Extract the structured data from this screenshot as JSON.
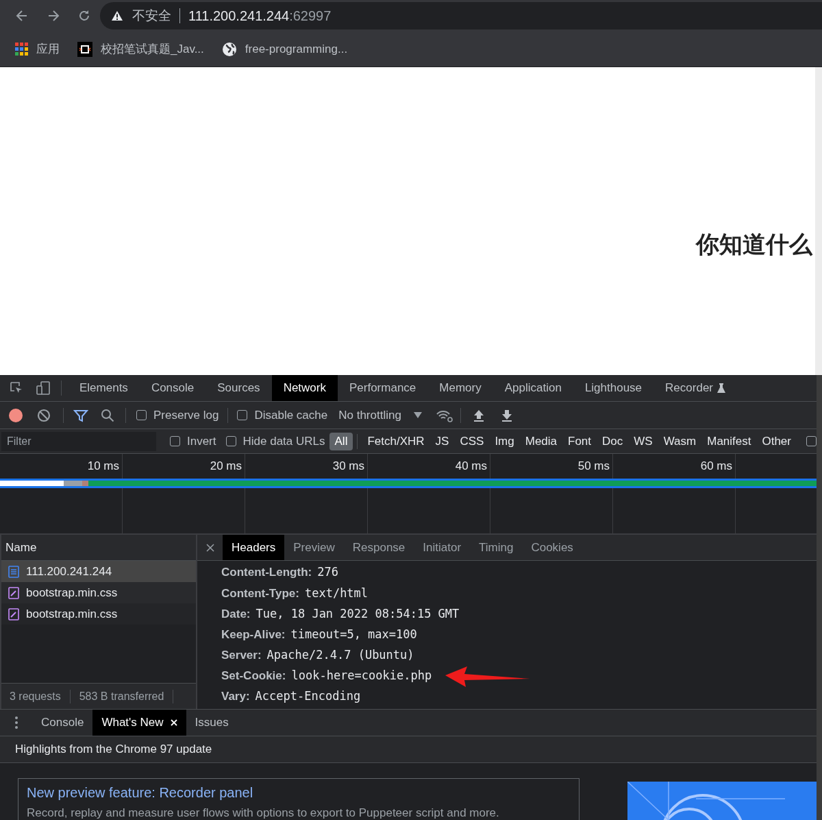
{
  "browser": {
    "security_label": "不安全",
    "url_host": "111.200.241.244",
    "url_port": ":62997",
    "bookmarks": [
      {
        "kind": "apps",
        "label": "应用"
      },
      {
        "kind": "site",
        "label": "校招笔试真题_Jav..."
      },
      {
        "kind": "globe",
        "label": "free-programming..."
      }
    ]
  },
  "page": {
    "heading": "你知道什么"
  },
  "devtools": {
    "tabs": [
      {
        "label": "Elements",
        "selected": false
      },
      {
        "label": "Console",
        "selected": false
      },
      {
        "label": "Sources",
        "selected": false
      },
      {
        "label": "Network",
        "selected": true
      },
      {
        "label": "Performance",
        "selected": false
      },
      {
        "label": "Memory",
        "selected": false
      },
      {
        "label": "Application",
        "selected": false
      },
      {
        "label": "Lighthouse",
        "selected": false
      },
      {
        "label": "Recorder",
        "selected": false
      }
    ],
    "toolbar": {
      "recording": true,
      "preserve_log": {
        "label": "Preserve log",
        "checked": false
      },
      "disable_cache": {
        "label": "Disable cache",
        "checked": false
      },
      "throttling": "No throttling"
    },
    "filter": {
      "placeholder": "Filter",
      "checkboxes": [
        {
          "label": "Invert",
          "checked": false
        },
        {
          "label": "Hide data URLs",
          "checked": false
        }
      ],
      "types": [
        {
          "label": "All",
          "selected": true
        },
        {
          "label": "Fetch/XHR",
          "selected": false
        },
        {
          "label": "JS",
          "selected": false
        },
        {
          "label": "CSS",
          "selected": false
        },
        {
          "label": "Img",
          "selected": false
        },
        {
          "label": "Media",
          "selected": false
        },
        {
          "label": "Font",
          "selected": false
        },
        {
          "label": "Doc",
          "selected": false
        },
        {
          "label": "WS",
          "selected": false
        },
        {
          "label": "Wasm",
          "selected": false
        },
        {
          "label": "Manifest",
          "selected": false
        },
        {
          "label": "Other",
          "selected": false
        }
      ],
      "trailing_checkbox": {
        "checked": false
      }
    },
    "timeline": {
      "ticks": [
        "10 ms",
        "20 ms",
        "30 ms",
        "40 ms",
        "50 ms",
        "60 ms"
      ]
    },
    "requests": {
      "column": "Name",
      "rows": [
        {
          "kind": "document",
          "name": "111.200.241.244",
          "selected": true
        },
        {
          "kind": "stylesheet",
          "name": "bootstrap.min.css",
          "selected": false
        },
        {
          "kind": "stylesheet",
          "name": "bootstrap.min.css",
          "selected": false
        }
      ],
      "summary": [
        "3 requests",
        "583 B transferred"
      ]
    },
    "detail_tabs": [
      {
        "label": "Headers",
        "selected": true
      },
      {
        "label": "Preview",
        "selected": false
      },
      {
        "label": "Response",
        "selected": false
      },
      {
        "label": "Initiator",
        "selected": false
      },
      {
        "label": "Timing",
        "selected": false
      },
      {
        "label": "Cookies",
        "selected": false
      }
    ],
    "headers": [
      {
        "name": "Content-Length:",
        "value": "276"
      },
      {
        "name": "Content-Type:",
        "value": "text/html"
      },
      {
        "name": "Date:",
        "value": "Tue, 18 Jan 2022 08:54:15 GMT"
      },
      {
        "name": "Keep-Alive:",
        "value": "timeout=5, max=100"
      },
      {
        "name": "Server:",
        "value": "Apache/2.4.7 (Ubuntu)"
      },
      {
        "name": "Set-Cookie:",
        "value": "look-here=cookie.php",
        "annotated": true
      },
      {
        "name": "Vary:",
        "value": "Accept-Encoding"
      }
    ],
    "drawer": {
      "tabs": [
        {
          "label": "Console",
          "selected": false,
          "closable": false
        },
        {
          "label": "What's New",
          "selected": true,
          "closable": true
        },
        {
          "label": "Issues",
          "selected": false,
          "closable": false
        }
      ],
      "heading": "Highlights from the Chrome 97 update",
      "card": {
        "title": "New preview feature: Recorder panel",
        "description": "Record, replay and measure user flows with options to export to Puppeteer script and more."
      }
    }
  }
}
